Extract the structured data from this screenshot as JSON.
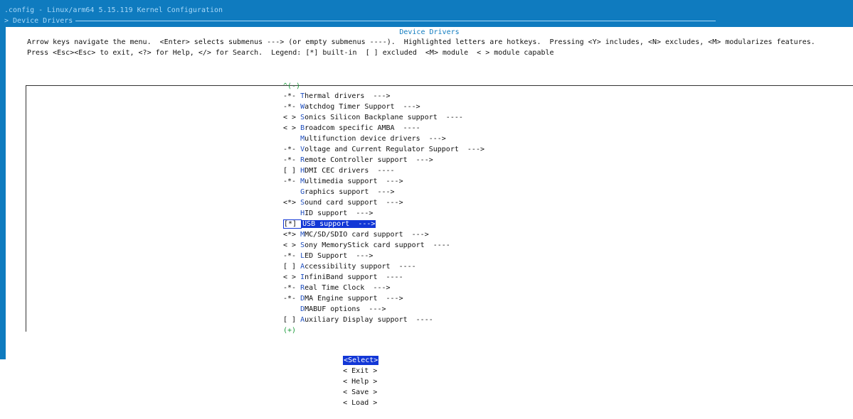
{
  "window": {
    "title": ".config - Linux/arm64 5.15.119 Kernel Configuration",
    "breadcrumb": "> Device Drivers"
  },
  "dialog": {
    "title": "Device Drivers",
    "help_line_1": "Arrow keys navigate the menu.  <Enter> selects submenus ---> (or empty submenus ----).  Highlighted letters are hotkeys.  Pressing <Y> includes, <N> excludes, <M> modularizes features.",
    "help_line_2": "Press <Esc><Esc> to exit, <?> for Help, </> for Search.  Legend: [*] built-in  [ ] excluded  <M> module  < > module capable",
    "scroll_up": "^(-)",
    "scroll_down": "(+)"
  },
  "menu": {
    "items": [
      {
        "prefix": "-*- ",
        "hotkey": "T",
        "rest": "hermal drivers  --->"
      },
      {
        "prefix": "-*- ",
        "hotkey": "W",
        "rest": "atchdog Timer Support  --->"
      },
      {
        "prefix": "< > ",
        "hotkey": "S",
        "rest": "onics Silicon Backplane support  ----"
      },
      {
        "prefix": "< > ",
        "hotkey": "B",
        "rest": "roadcom specific AMBA  ----"
      },
      {
        "prefix": "    ",
        "hotkey": "M",
        "rest": "ultifunction device drivers  --->"
      },
      {
        "prefix": "-*- ",
        "hotkey": "V",
        "rest": "oltage and Current Regulator Support  --->"
      },
      {
        "prefix": "-*- ",
        "hotkey": "R",
        "rest": "emote Controller support  --->"
      },
      {
        "prefix": "[ ] ",
        "hotkey": "H",
        "rest": "DMI CEC drivers  ----"
      },
      {
        "prefix": "-*- ",
        "hotkey": "M",
        "rest": "ultimedia support  --->"
      },
      {
        "prefix": "    ",
        "hotkey": "G",
        "rest": "raphics support  --->"
      },
      {
        "prefix": "<*> ",
        "hotkey": "S",
        "rest": "ound card support  --->"
      },
      {
        "prefix": "    ",
        "hotkey": "H",
        "rest": "ID support  --->"
      },
      {
        "prefix": "[*] ",
        "hotkey": "U",
        "rest": "SB support  --->",
        "selected": true
      },
      {
        "prefix": "<*> ",
        "hotkey": "M",
        "rest": "MC/SD/SDIO card support  --->"
      },
      {
        "prefix": "< > ",
        "hotkey": "S",
        "rest": "ony MemoryStick card support  ----"
      },
      {
        "prefix": "-*- ",
        "hotkey": "L",
        "rest": "ED Support  --->"
      },
      {
        "prefix": "[ ] ",
        "hotkey": "A",
        "rest": "ccessibility support  ----"
      },
      {
        "prefix": "< > ",
        "hotkey": "I",
        "rest": "nfiniBand support  ----"
      },
      {
        "prefix": "-*- ",
        "hotkey": "R",
        "rest": "eal Time Clock  --->"
      },
      {
        "prefix": "-*- ",
        "hotkey": "D",
        "rest": "MA Engine support  --->"
      },
      {
        "prefix": "    ",
        "hotkey": "D",
        "rest": "MABUF options  --->"
      },
      {
        "prefix": "[ ] ",
        "hotkey": "A",
        "rest": "uxiliary Display support  ----"
      }
    ]
  },
  "buttons": {
    "select": "<Select>",
    "exit": "< Exit >",
    "help": "< Help >",
    "save": "< Save >",
    "load": "< Load >"
  },
  "colors": {
    "terminal_bg": "#0f7bbf",
    "selection_bg": "#1237d6",
    "hotkey": "#1f4fbf",
    "scroll_indicator": "#1a9a3a"
  }
}
